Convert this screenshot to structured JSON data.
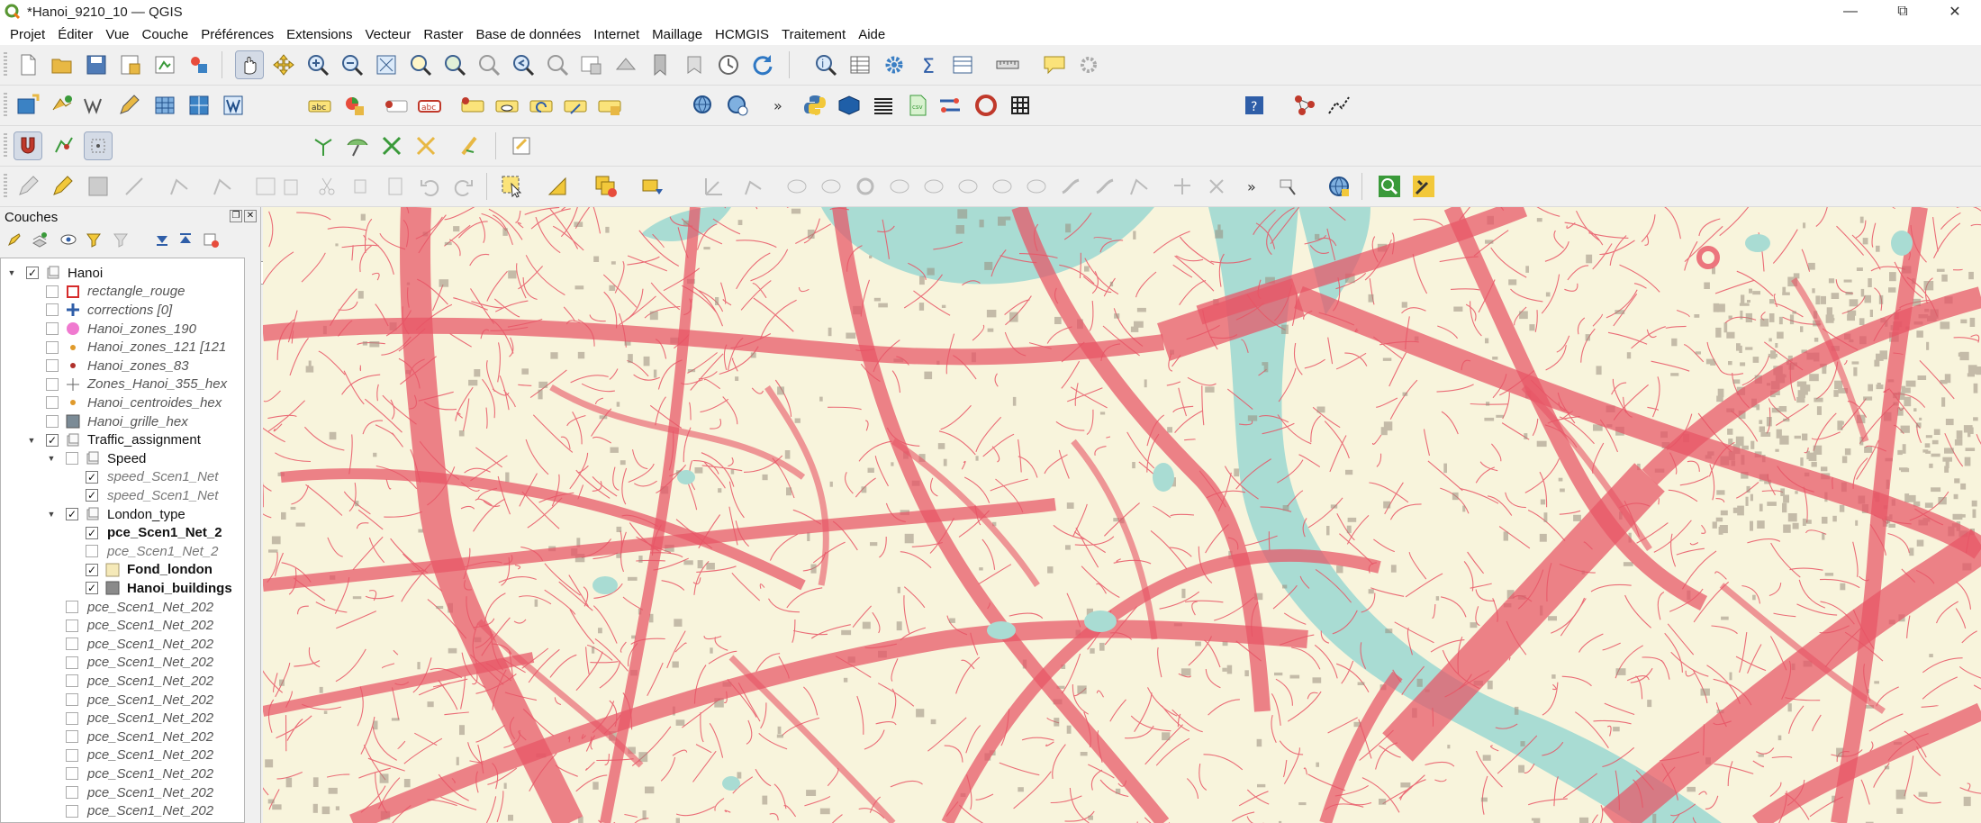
{
  "window": {
    "title": "*Hanoi_9210_10 — QGIS",
    "controls": [
      "minimize",
      "maximize",
      "close"
    ]
  },
  "menu": [
    "Projet",
    "Éditer",
    "Vue",
    "Couche",
    "Préférences",
    "Extensions",
    "Vecteur",
    "Raster",
    "Base de données",
    "Internet",
    "Maillage",
    "HCMGIS",
    "Traitement",
    "Aide"
  ],
  "snapping": {
    "tolerance": "10",
    "unit": "px"
  },
  "layers_panel": {
    "title": "Couches",
    "tree": [
      {
        "label": "Hanoi",
        "style": "normal",
        "checked": true,
        "expanded": true,
        "kind": "group"
      },
      {
        "label": "rectangle_rouge",
        "style": "it",
        "checked": false,
        "kind": "layer"
      },
      {
        "label": "corrections [0]",
        "style": "it",
        "checked": false,
        "kind": "layer"
      },
      {
        "label": "Hanoi_zones_190",
        "style": "it",
        "checked": false,
        "kind": "layer"
      },
      {
        "label": "Hanoi_zones_121 [121",
        "style": "it",
        "checked": false,
        "kind": "layer"
      },
      {
        "label": "Hanoi_zones_83",
        "style": "it",
        "checked": false,
        "kind": "layer"
      },
      {
        "label": "Zones_Hanoi_355_hex",
        "style": "it",
        "checked": false,
        "kind": "layer"
      },
      {
        "label": "Hanoi_centroides_hex",
        "style": "it",
        "checked": false,
        "kind": "layer"
      },
      {
        "label": "Hanoi_grille_hex",
        "style": "it",
        "checked": false,
        "kind": "layer"
      },
      {
        "label": "Traffic_assignment",
        "style": "normal",
        "checked": true,
        "expanded": true,
        "kind": "group"
      },
      {
        "label": "Speed",
        "style": "normal",
        "checked": false,
        "expanded": true,
        "kind": "group"
      },
      {
        "label": "speed_Scen1_Net",
        "style": "itdim",
        "checked": true,
        "kind": "layer"
      },
      {
        "label": "speed_Scen1_Net",
        "style": "itdim",
        "checked": true,
        "kind": "layer"
      },
      {
        "label": "London_type",
        "style": "normal",
        "checked": true,
        "expanded": true,
        "kind": "group"
      },
      {
        "label": "pce_Scen1_Net_2",
        "style": "bold",
        "checked": true,
        "kind": "layer"
      },
      {
        "label": "pce_Scen1_Net_2",
        "style": "itdim",
        "checked": false,
        "kind": "layer"
      },
      {
        "label": "Fond_london",
        "style": "bold",
        "checked": true,
        "kind": "layer"
      },
      {
        "label": "Hanoi_buildings",
        "style": "bold",
        "checked": true,
        "kind": "layer"
      },
      {
        "label": "pce_Scen1_Net_202",
        "style": "it",
        "checked": false,
        "kind": "layer"
      },
      {
        "label": "pce_Scen1_Net_202",
        "style": "it",
        "checked": false,
        "kind": "layer"
      },
      {
        "label": "pce_Scen1_Net_202",
        "style": "it",
        "checked": false,
        "kind": "layer"
      },
      {
        "label": "pce_Scen1_Net_202",
        "style": "it",
        "checked": false,
        "kind": "layer"
      },
      {
        "label": "pce_Scen1_Net_202",
        "style": "it",
        "checked": false,
        "kind": "layer"
      },
      {
        "label": "pce_Scen1_Net_202",
        "style": "it",
        "checked": false,
        "kind": "layer"
      },
      {
        "label": "pce_Scen1_Net_202",
        "style": "it",
        "checked": false,
        "kind": "layer"
      },
      {
        "label": "pce_Scen1_Net_202",
        "style": "it",
        "checked": false,
        "kind": "layer"
      },
      {
        "label": "pce_Scen1_Net_202",
        "style": "it",
        "checked": false,
        "kind": "layer"
      },
      {
        "label": "pce_Scen1_Net_202",
        "style": "it",
        "checked": false,
        "kind": "layer"
      },
      {
        "label": "pce_Scen1_Net_202",
        "style": "it",
        "checked": false,
        "kind": "layer"
      },
      {
        "label": "pce_Scen1_Net_202",
        "style": "it",
        "checked": false,
        "kind": "layer"
      }
    ]
  },
  "colors": {
    "map_background": "#f8f4dc",
    "river": "#a9dcd3",
    "roads": "#e85565",
    "buildings": "#9a8e7e",
    "selection_red": "#d62b2b"
  },
  "icons": {
    "qgis_logo": "qgis-logo-icon",
    "pan": "pan-hand-icon",
    "python": "python-icon",
    "help": "help-icon"
  }
}
